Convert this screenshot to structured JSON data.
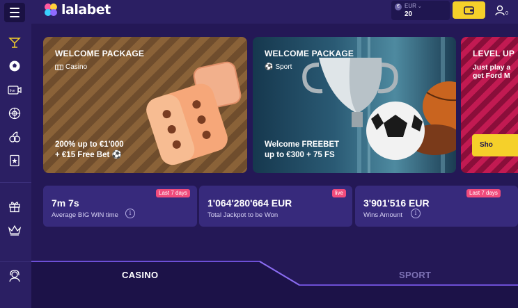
{
  "header": {
    "brand": "lalabet",
    "currency": "EUR",
    "balance": "20",
    "user_badge": "0"
  },
  "sidebar": {
    "items": [
      {
        "icon": "cocktail-icon"
      },
      {
        "icon": "soccer-ball-icon"
      },
      {
        "icon": "live-tv-icon",
        "label": "live"
      },
      {
        "icon": "roulette-icon"
      },
      {
        "icon": "cherries-icon"
      },
      {
        "icon": "lottery-ticket-icon"
      },
      {
        "icon": "gift-icon"
      },
      {
        "icon": "crown-icon"
      },
      {
        "icon": "support-agent-icon"
      }
    ]
  },
  "banners": [
    {
      "title": "WELCOME PACKAGE",
      "tag": "Casino",
      "offer_line1": "200% up to €1'000",
      "offer_line2": "+ €15 Free Bet"
    },
    {
      "title": "WELCOME PACKAGE",
      "tag": "Sport",
      "offer_line1": "Welcome FREEBET",
      "offer_line2": "up to €300 + 75 FS"
    },
    {
      "title": "LEVEL UP",
      "sub_line1": "Just play a",
      "sub_line2": "get Ford M",
      "button": "Sho"
    }
  ],
  "stats": [
    {
      "badge": "Last 7 days",
      "value": "7m 7s",
      "label": "Average BIG WIN time"
    },
    {
      "badge": "live",
      "value": "1'064'280'664 EUR",
      "label": "Total Jackpot to be Won"
    },
    {
      "badge": "Last 7 days",
      "value": "3'901'516 EUR",
      "label": "Wins Amount"
    }
  ],
  "tabs": {
    "casino": "CASINO",
    "sport": "SPORT"
  },
  "colors": {
    "accent_yellow": "#f5d02a",
    "badge_pink": "#f04b7c",
    "background": "#241856"
  }
}
